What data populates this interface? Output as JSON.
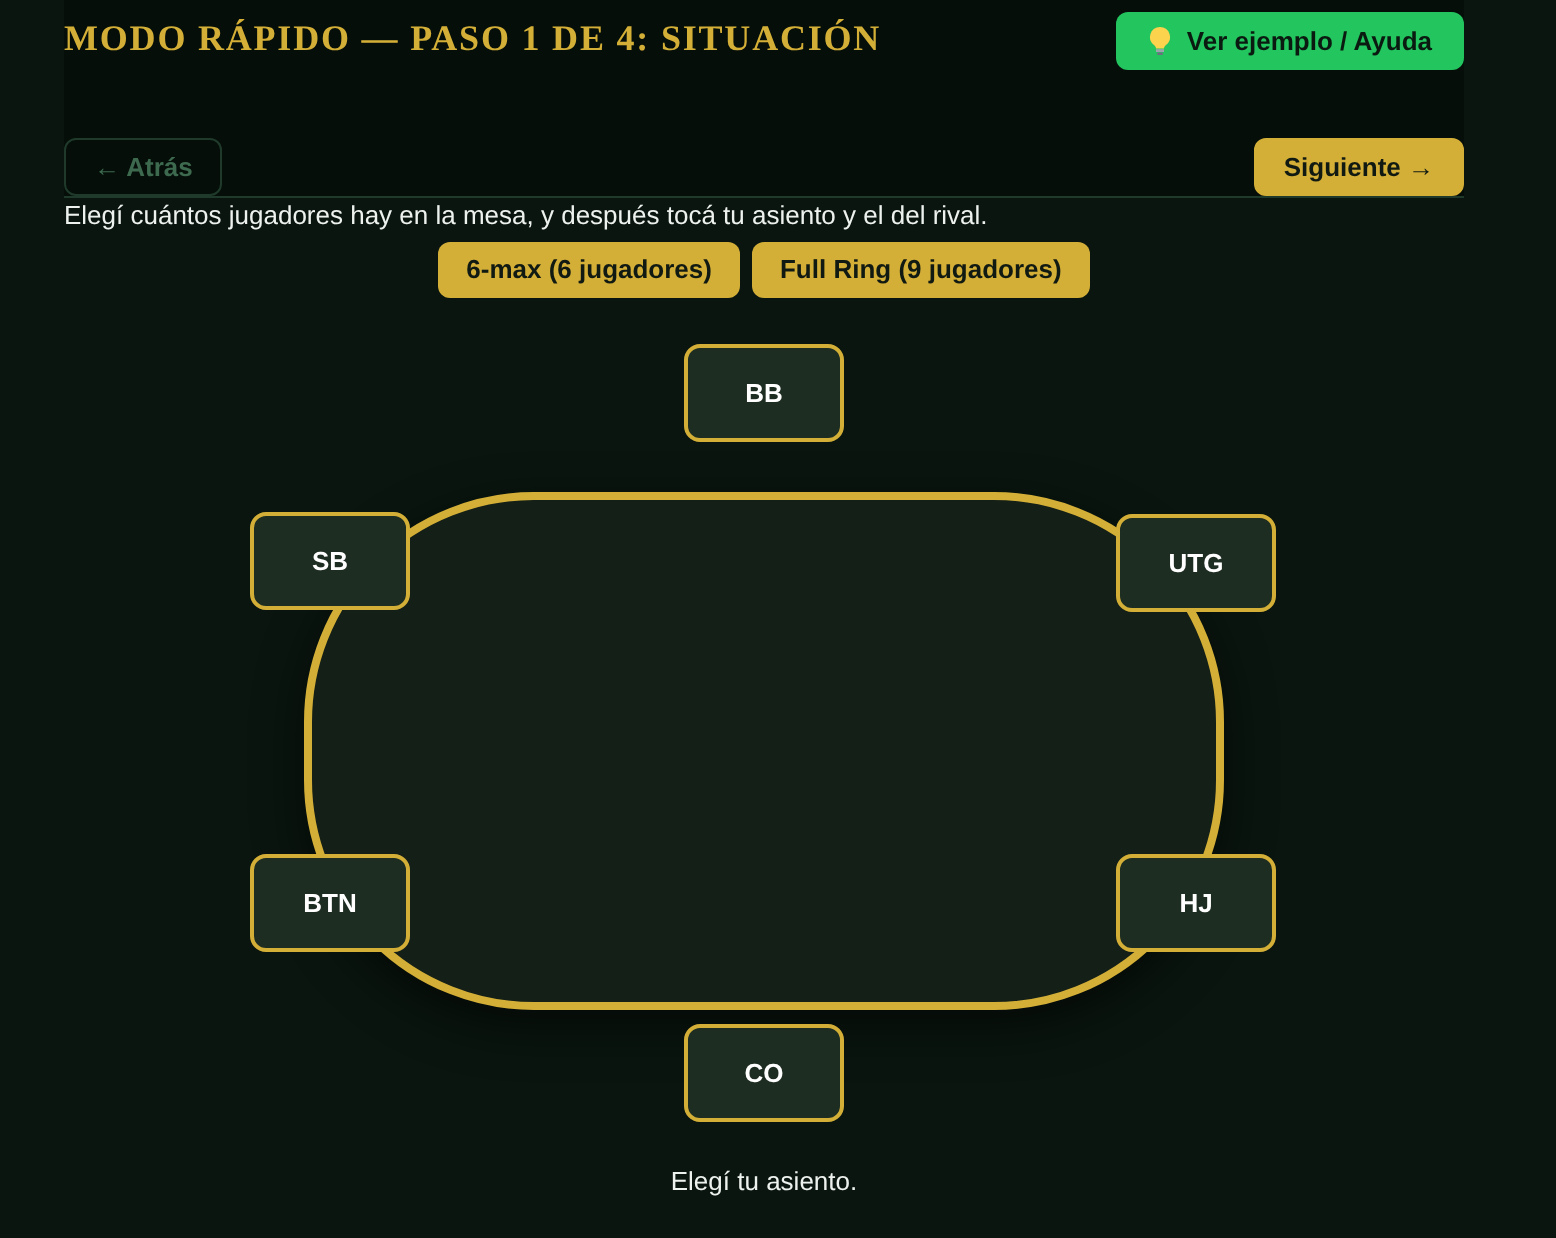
{
  "header": {
    "title": "MODO RÁPIDO — PASO 1 DE 4: SITUACIÓN",
    "help_button": {
      "label": "Ver ejemplo / Ayuda"
    }
  },
  "nav": {
    "back": {
      "label": "← Atrás",
      "disabled": true
    },
    "next": {
      "label": "Siguiente →",
      "disabled": false
    }
  },
  "instruction": "Elegí cuántos jugadores hay en la mesa, y después tocá tu asiento y el del rival.",
  "table_size_options": [
    {
      "label": "6-max (6 jugadores)"
    },
    {
      "label": "Full Ring (9 jugadores)"
    }
  ],
  "seats": [
    {
      "label": "BB"
    },
    {
      "label": "SB"
    },
    {
      "label": "UTG"
    },
    {
      "label": "BTN"
    },
    {
      "label": "HJ"
    },
    {
      "label": "CO"
    }
  ],
  "prompt": "Elegí tu asiento."
}
